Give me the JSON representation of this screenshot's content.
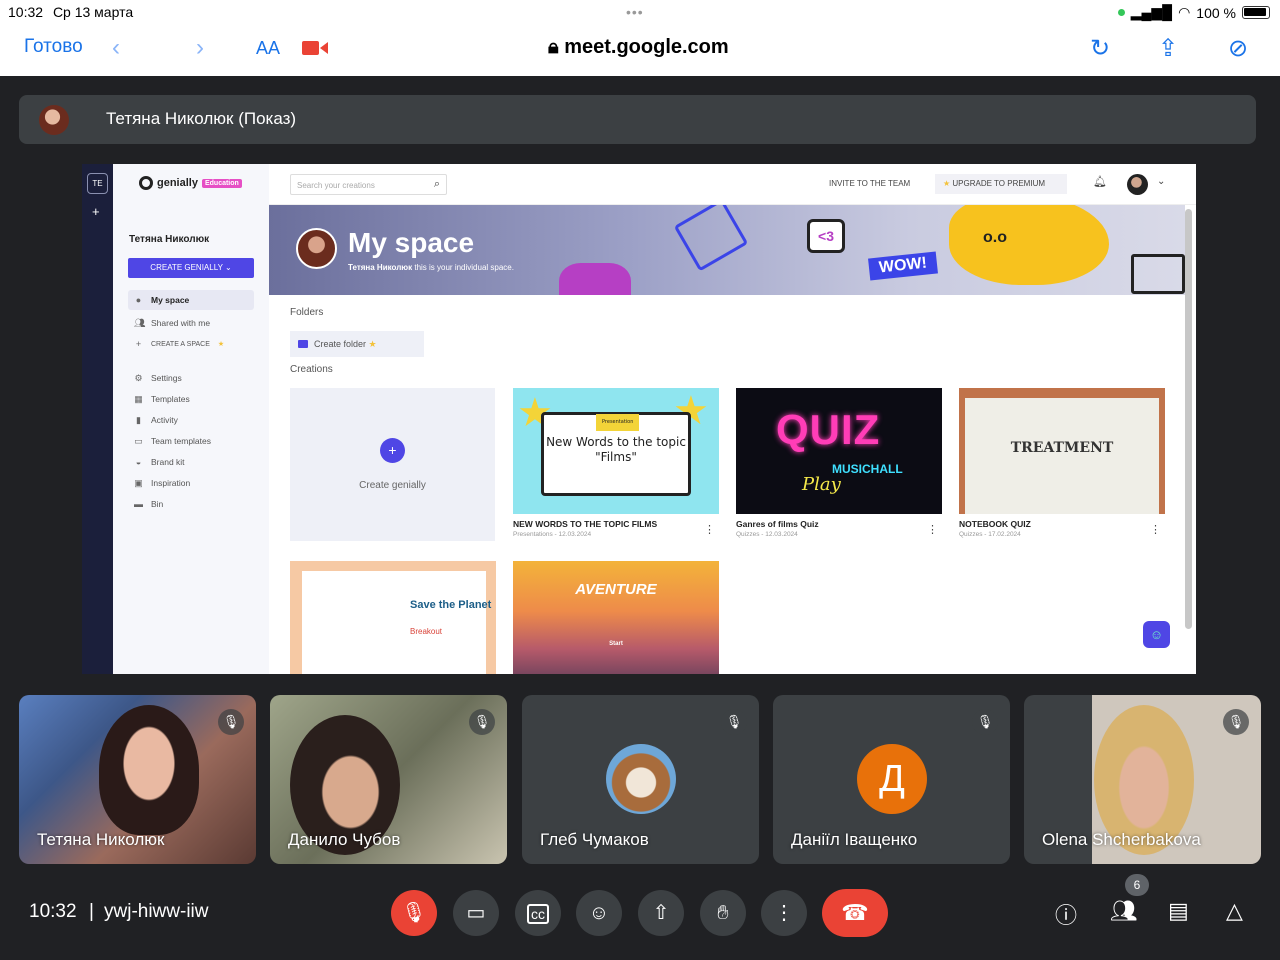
{
  "ios_status": {
    "time": "10:32",
    "date": "Ср 13 марта",
    "battery": "100 %"
  },
  "safari": {
    "done_label": "Готово",
    "text_size_label": "AA",
    "url": "meet.google.com",
    "accent_color": "#1a73e8"
  },
  "presenter": {
    "name": "Тетяна Николюк (Показ)"
  },
  "shared_screen": {
    "rail_badge": "ТЕ",
    "logo_text": "genially",
    "logo_badge": "Education",
    "user_name": "Тетяна Николюк",
    "create_button": "CREATE GENIALLY",
    "nav": [
      {
        "label": "My space",
        "icon": "user-avatar-icon"
      },
      {
        "label": "Shared with me",
        "icon": "people-icon"
      },
      {
        "label": "CREATE A SPACE",
        "icon": "plus-icon"
      },
      {
        "label": "Settings",
        "icon": "gear-icon"
      },
      {
        "label": "Templates",
        "icon": "grid-icon"
      },
      {
        "label": "Activity",
        "icon": "bar-chart-icon"
      },
      {
        "label": "Team templates",
        "icon": "team-templates-icon"
      },
      {
        "label": "Brand kit",
        "icon": "palette-icon"
      },
      {
        "label": "Inspiration",
        "icon": "inspiration-icon"
      },
      {
        "label": "Bin",
        "icon": "trash-icon"
      }
    ],
    "search_placeholder": "Search your creations",
    "invite_label": "INVITE TO THE TEAM",
    "premium_label": "UPGRADE TO PREMIUM",
    "banner_title": "My space",
    "banner_sub_name": "Тетяна Николюк",
    "banner_sub_text": "this is your individual space.",
    "banner_eyes": "o.o",
    "banner_wow": "WOW!",
    "banner_heart": "<3",
    "folders_label": "Folders",
    "create_folder_label": "Create folder",
    "creations_label": "Creations",
    "create_genially_label": "Create genially",
    "cards": [
      {
        "title": "NEW WORDS TO THE TOPIC FILMS",
        "meta": "Presentations - 12.03.2024",
        "thumb_text": "New Words to the topic \"Films\"",
        "thumb_badge": "Presentation"
      },
      {
        "title": "Ganres of films Quiz",
        "meta": "Quizzes - 12.03.2024",
        "thumb_text": "QUIZ",
        "thumb_sub": "MUSICHALL",
        "thumb_play": "Play"
      },
      {
        "title": "NOTEBOOK QUIZ",
        "meta": "Quizzes - 17.02.2024",
        "thumb_text": "TREATMENT"
      },
      {
        "thumb_title": "Save the Planet",
        "thumb_sub": "Breakout"
      },
      {
        "thumb_title": "AVENTURE",
        "thumb_sub": "Start"
      }
    ]
  },
  "participants": [
    {
      "name": "Тетяна Николюк",
      "muted": true
    },
    {
      "name": "Данило Чубов",
      "muted": true
    },
    {
      "name": "Глеб Чумаков",
      "muted": true
    },
    {
      "name": "Даніїл Іващенко",
      "muted": true,
      "initial": "Д",
      "avatar_color": "#e8710a"
    },
    {
      "name": "Olena Shcherbakova",
      "muted": true
    }
  ],
  "bottom_bar": {
    "time": "10:32",
    "separator": "|",
    "meeting_code": "ywj-hiww-iiw",
    "participant_count": "6",
    "end_call_color": "#ea4335"
  }
}
